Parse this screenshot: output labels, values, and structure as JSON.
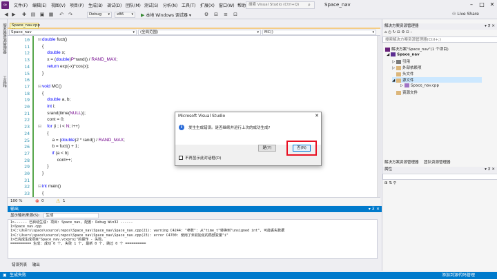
{
  "menubar": {
    "items": [
      "文件(F)",
      "编辑(E)",
      "视图(V)",
      "项目(P)",
      "生成(B)",
      "调试(D)",
      "团队(M)",
      "测试(S)",
      "分析(N)",
      "工具(T)",
      "扩展(X)",
      "窗口(W)",
      "帮助(H)"
    ],
    "search_placeholder": "搜索 Visual Studio (Ctrl+Q)",
    "solution_name": "Space_nav",
    "live_share": "Live Share"
  },
  "toolbar": {
    "config": "Debug",
    "platform": "x86",
    "run_label": "本地 Windows 调试器"
  },
  "left_strip": {
    "server_explorer": "服务器资源管理器",
    "toolbox": "工具箱"
  },
  "document": {
    "tab_name": "Space_nav.cpp",
    "nav_project": "Space_nav",
    "nav_scope": "(全局范围)",
    "nav_member": "MC()"
  },
  "code_lines": [
    {
      "num": "10",
      "text": "double fuct()"
    },
    {
      "num": "11",
      "text": "{"
    },
    {
      "num": "12",
      "text": "    double x;"
    },
    {
      "num": "13",
      "text": "    x = (double)P*rand() / RAND_MAX;"
    },
    {
      "num": "14",
      "text": "    return exp(-x)*cos(x);"
    },
    {
      "num": "15",
      "text": "}"
    },
    {
      "num": "16",
      "text": ""
    },
    {
      "num": "17",
      "text": "void MC()"
    },
    {
      "num": "18",
      "text": "{"
    },
    {
      "num": "19",
      "text": "    double a, b;"
    },
    {
      "num": "20",
      "text": "    int i;"
    },
    {
      "num": "21",
      "text": "    srand(time(NULL));"
    },
    {
      "num": "22",
      "text": "    cont = 0;"
    },
    {
      "num": "23",
      "text": "    for (i ; i < N; i++)"
    },
    {
      "num": "24",
      "text": "    {"
    },
    {
      "num": "25",
      "text": "        a = (double)2 * rand() / RAND_MAX;"
    },
    {
      "num": "26",
      "text": "        b = fuct() + 1;"
    },
    {
      "num": "27",
      "text": "        if (a < b)"
    },
    {
      "num": "28",
      "text": "            cont++;"
    },
    {
      "num": "29",
      "text": "    }"
    },
    {
      "num": "30",
      "text": "}"
    },
    {
      "num": "31",
      "text": ""
    },
    {
      "num": "32",
      "text": "int main()"
    },
    {
      "num": "33",
      "text": "{"
    }
  ],
  "editor_status": {
    "zoom": "100 %",
    "errors": "0",
    "warnings": "1",
    "col_info": "ln: 1"
  },
  "output": {
    "title": "输出",
    "source_label": "显示输出来源(S):",
    "source_value": "生成",
    "lines": [
      "1>------ 已启动生成: 项目: Space_nav, 配置: Debug Win32 ------",
      "1>Space_nav.cpp",
      "1>C:\\Users\\space\\source\\repos\\Space_nav\\Space_nav\\Space_nav.cpp(21): warning C4244: \"参数\": 从\"time_t\"转换到\"unsigned int\", 可能丢失数据",
      "1>C:\\Users\\space\\source\\repos\\Space_nav\\Space_nav\\Space_nav.cpp(23): error C4700: 使用了未初始化的局部变量\"i\"",
      "1>已完成生成项目\"Space_nav.vcxproj\"的操作 - 失败。",
      "========== 生成: 成功 0 个, 失败 1 个, 最新 0 个, 跳过 0 个 =========="
    ],
    "tabs": [
      "错误列表",
      "输出"
    ]
  },
  "statusbar": {
    "left": "生成失败",
    "right": "添加到源代码管理"
  },
  "solution_explorer": {
    "title": "解决方案资源管理器",
    "search_placeholder": "搜索解决方案资源管理器(Ctrl+;)",
    "solution_label": "解决方案\"Space_nav\"(1 个项目)",
    "project": "Space_nav",
    "items": [
      "引用",
      "外部依赖项",
      "头文件",
      "源文件",
      "Space_nav.cpp",
      "资源文件"
    ],
    "bottom_tabs": [
      "解决方案资源管理器",
      "团队资源管理器"
    ],
    "properties_title": "属性"
  },
  "dialog": {
    "title": "Microsoft Visual Studio",
    "message": "发生生成错误。是否继续并运行上次的成功生成?",
    "yes_label": "是(Y)",
    "no_label": "否(N)",
    "checkbox_label": "不再显示此对话框(D)"
  }
}
